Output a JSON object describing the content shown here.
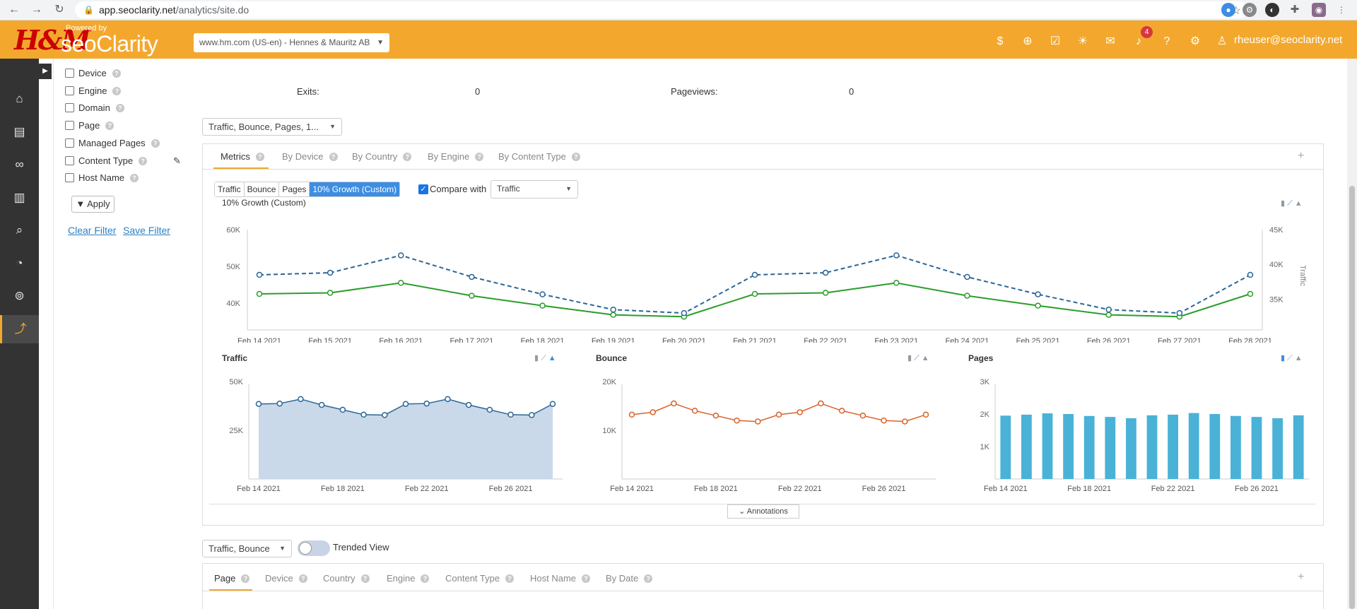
{
  "browser": {
    "url_host": "app.seoclarity.net",
    "url_path": "/analytics/site.do"
  },
  "header": {
    "brand_client": "H&M",
    "powered_by": "Powered by",
    "brand_name": "seoClarity",
    "site_selector": "www.hm.com (US-en) - Hennes & Mauritz AB",
    "notification_count": "4",
    "user": "rheuser@seoclarity.net"
  },
  "filters": {
    "items": [
      "Device",
      "Engine",
      "Domain",
      "Page",
      "Managed Pages",
      "Content Type",
      "Host Name"
    ],
    "apply_label": "Apply",
    "clear_label": "Clear Filter",
    "save_label": "Save Filter"
  },
  "summary": {
    "exits_label": "Exits:",
    "exits_value": "0",
    "pageviews_label": "Pageviews:",
    "pageviews_value": "0"
  },
  "metrics_dropdown": "Traffic, Bounce, Pages, 1...",
  "chart_tabs": [
    {
      "label": "Metrics"
    },
    {
      "label": "By Device"
    },
    {
      "label": "By Country"
    },
    {
      "label": "By Engine"
    },
    {
      "label": "By Content Type"
    }
  ],
  "metric_buttons": [
    "Traffic",
    "Bounce",
    "Pages",
    "10% Growth (Custom)"
  ],
  "compare": {
    "label": "Compare with",
    "value": "Traffic"
  },
  "annotations_label": "Annotations",
  "bottom": {
    "dropdown": "Traffic, Bounce",
    "trended_label": "Trended View",
    "tabs": [
      "Page",
      "Device",
      "Country",
      "Engine",
      "Content Type",
      "Host Name",
      "By Date"
    ]
  },
  "colors": {
    "accent": "#f3a82d",
    "traffic_blue": "#2a6596",
    "growth_green": "#2a9d2a",
    "bounce_orange": "#d9622b",
    "pages_bar": "#4ab2d6"
  },
  "chart_data": [
    {
      "type": "line",
      "title": "10% Growth (Custom)",
      "x": [
        "Feb 14 2021",
        "Feb 15 2021",
        "Feb 16 2021",
        "Feb 17 2021",
        "Feb 18 2021",
        "Feb 19 2021",
        "Feb 20 2021",
        "Feb 21 2021",
        "Feb 22 2021",
        "Feb 23 2021",
        "Feb 24 2021",
        "Feb 25 2021",
        "Feb 26 2021",
        "Feb 27 2021",
        "Feb 28 2021"
      ],
      "ylim_left": [
        35000,
        60000
      ],
      "yticks_left": [
        "60K",
        "50K",
        "40K"
      ],
      "ylim_right": [
        31800,
        45000
      ],
      "yticks_right": [
        "45K",
        "40K",
        "35K"
      ],
      "ylabel_right": "Traffic",
      "series": [
        {
          "axis": "left",
          "style": "solid",
          "color": "#2a9d2a",
          "values": [
            42500,
            42800,
            45500,
            42000,
            39300,
            36800,
            36300,
            42500,
            42800,
            45500,
            42000,
            39300,
            36800,
            36300,
            42500
          ]
        },
        {
          "axis": "right",
          "style": "dashed",
          "color": "#2a6596",
          "values": [
            38500,
            38800,
            41300,
            38200,
            35700,
            33500,
            33000,
            38500,
            38800,
            41300,
            38200,
            35700,
            33500,
            33000,
            38500
          ]
        }
      ]
    },
    {
      "type": "area",
      "title": "Traffic",
      "x": [
        "Feb 14 2021",
        "Feb 15 2021",
        "Feb 16 2021",
        "Feb 17 2021",
        "Feb 18 2021",
        "Feb 19 2021",
        "Feb 20 2021",
        "Feb 21 2021",
        "Feb 22 2021",
        "Feb 23 2021",
        "Feb 24 2021",
        "Feb 25 2021",
        "Feb 26 2021",
        "Feb 27 2021",
        "Feb 28 2021"
      ],
      "xticks": [
        "Feb 14 2021",
        "Feb 18 2021",
        "Feb 22 2021",
        "Feb 26 2021"
      ],
      "ylim": [
        0,
        50000
      ],
      "yticks": [
        "50K",
        "25K"
      ],
      "values": [
        38500,
        38700,
        41000,
        38000,
        35500,
        33000,
        32800,
        38500,
        38700,
        41000,
        38000,
        35500,
        33000,
        32800,
        38500
      ]
    },
    {
      "type": "line",
      "title": "Bounce",
      "x": [
        "Feb 14 2021",
        "Feb 15 2021",
        "Feb 16 2021",
        "Feb 17 2021",
        "Feb 18 2021",
        "Feb 19 2021",
        "Feb 20 2021",
        "Feb 21 2021",
        "Feb 22 2021",
        "Feb 23 2021",
        "Feb 24 2021",
        "Feb 25 2021",
        "Feb 26 2021",
        "Feb 27 2021",
        "Feb 28 2021"
      ],
      "xticks": [
        "Feb 14 2021",
        "Feb 18 2021",
        "Feb 22 2021",
        "Feb 26 2021"
      ],
      "ylim": [
        0,
        20000
      ],
      "yticks": [
        "20K",
        "10K"
      ],
      "values": [
        13200,
        13700,
        15500,
        14000,
        13000,
        12000,
        11800,
        13200,
        13700,
        15500,
        14000,
        13000,
        12000,
        11800,
        13200
      ]
    },
    {
      "type": "bar",
      "title": "Pages",
      "x": [
        "Feb 14 2021",
        "Feb 15 2021",
        "Feb 16 2021",
        "Feb 17 2021",
        "Feb 18 2021",
        "Feb 19 2021",
        "Feb 20 2021",
        "Feb 21 2021",
        "Feb 22 2021",
        "Feb 23 2021",
        "Feb 24 2021",
        "Feb 25 2021",
        "Feb 26 2021",
        "Feb 27 2021",
        "Feb 28 2021"
      ],
      "xticks": [
        "Feb 14 2021",
        "Feb 18 2021",
        "Feb 22 2021",
        "Feb 26 2021"
      ],
      "ylim": [
        0,
        3000
      ],
      "yticks": [
        "3K",
        "2K",
        "1K"
      ],
      "values": [
        1950,
        1980,
        2020,
        2000,
        1940,
        1910,
        1870,
        1960,
        1980,
        2030,
        2000,
        1940,
        1910,
        1870,
        1960
      ]
    }
  ]
}
